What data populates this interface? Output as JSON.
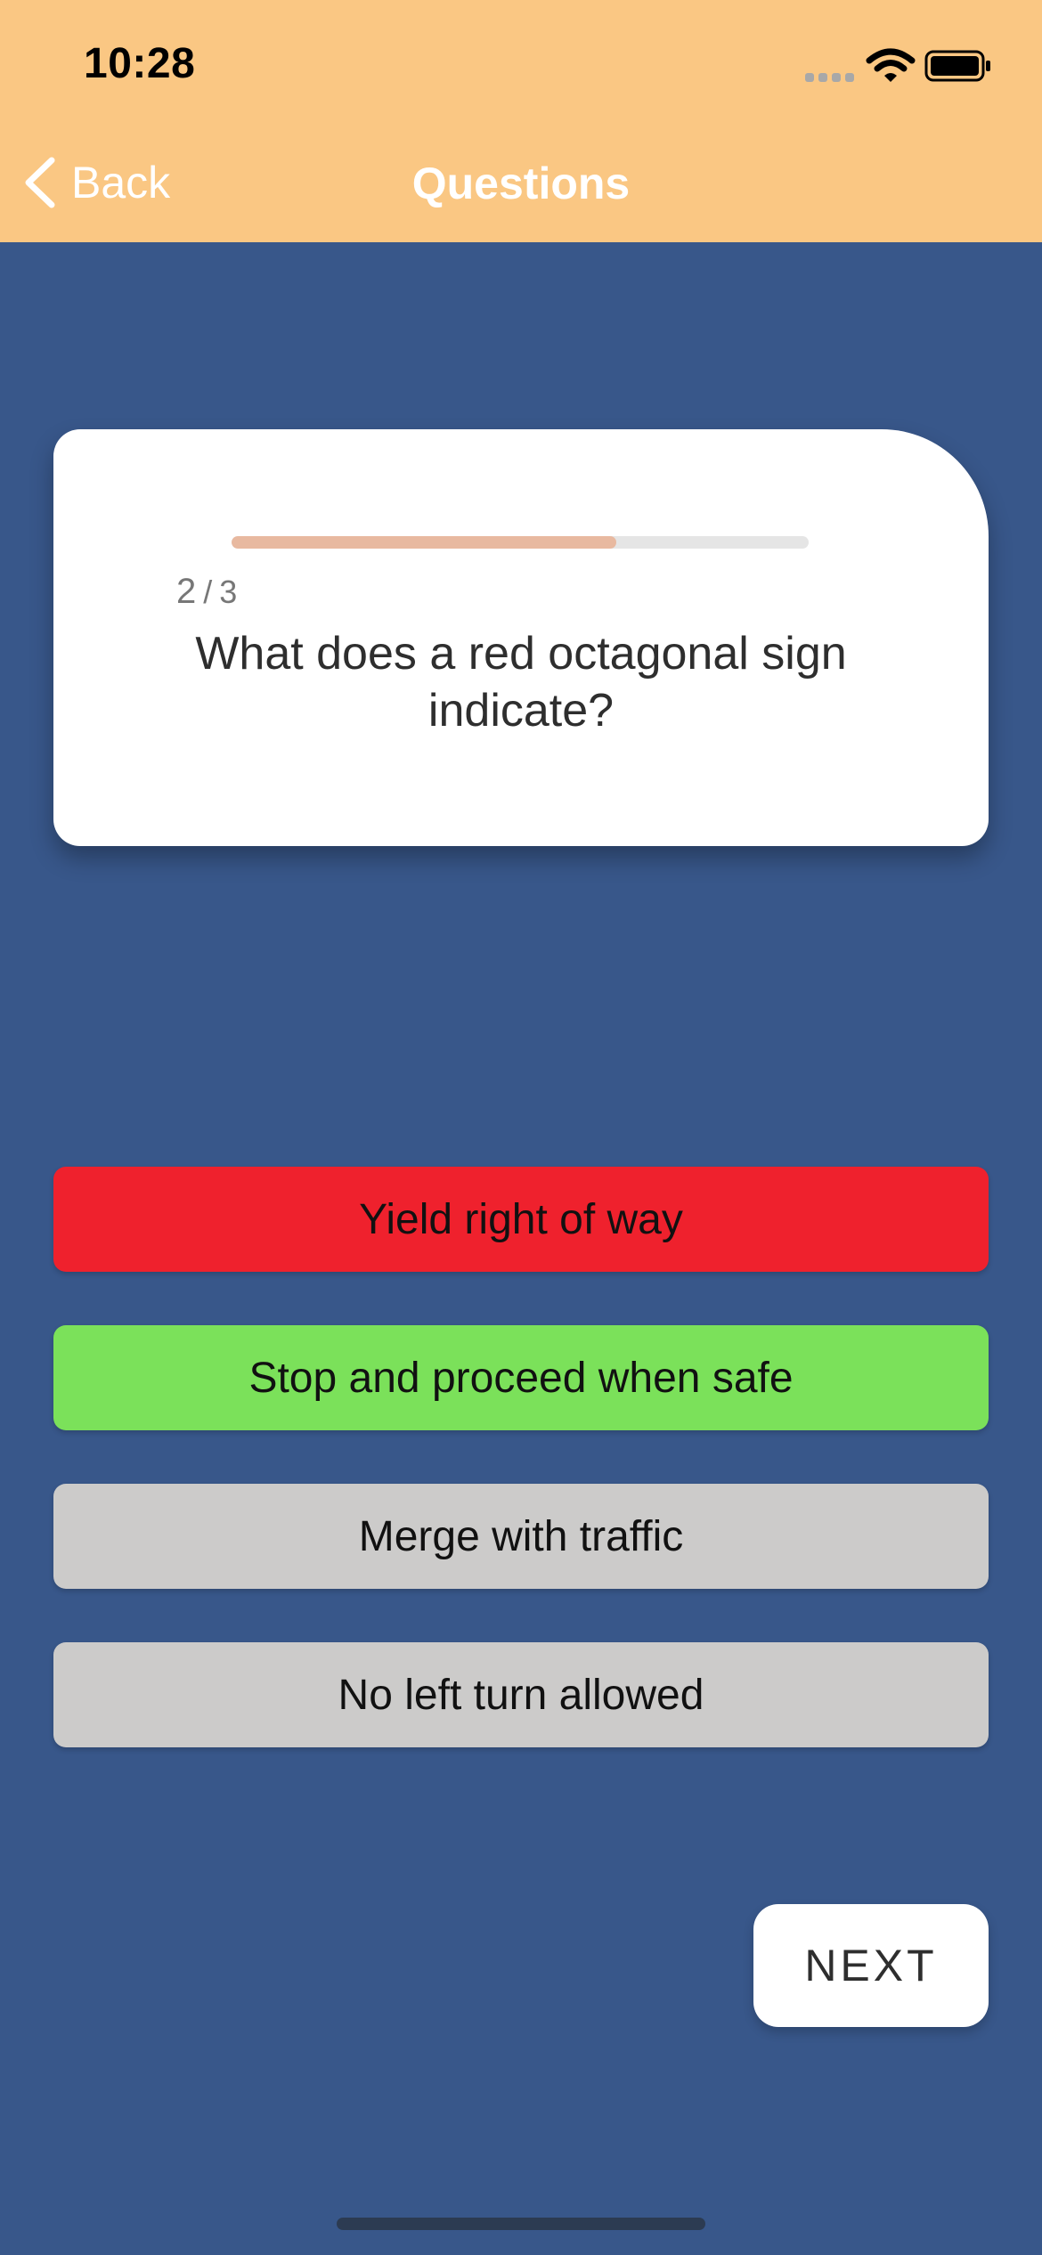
{
  "status_bar": {
    "time": "10:28"
  },
  "nav": {
    "back_label": "Back",
    "title": "Questions"
  },
  "question": {
    "current": "2",
    "separator": "/",
    "total": "3",
    "progress": 0.667,
    "text": "What does a red octagonal sign indicate?"
  },
  "answers": [
    {
      "label": "Yield right of way",
      "state": "incorrect",
      "color": "#EF212D"
    },
    {
      "label": "Stop and proceed when safe",
      "state": "correct",
      "color": "#7BE15A"
    },
    {
      "label": "Merge with traffic",
      "state": "neutral",
      "color": "#CCCBCA"
    },
    {
      "label": "No left turn allowed",
      "state": "neutral",
      "color": "#CCCBCA"
    }
  ],
  "next_button": {
    "label": "NEXT"
  },
  "colors": {
    "header": "#FAC783",
    "background": "#38578A",
    "card": "#FFFFFF",
    "progress_fill": "#E8B9A0",
    "progress_track": "#E5E5E5"
  },
  "icons": {
    "back": "chevron-left-icon",
    "signal": "cellular-signal-icon",
    "wifi": "wifi-icon",
    "battery": "battery-icon"
  }
}
